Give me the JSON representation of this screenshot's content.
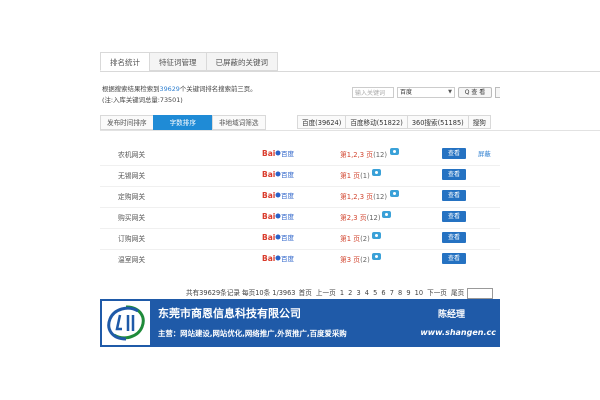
{
  "tabs_top": [
    "排名统计",
    "特征词管理",
    "已屏蔽的关键词"
  ],
  "summary": {
    "line1_prefix": "根据搜索结果检索到",
    "line1_count": "39629",
    "line1_suffix": "个关键词排名搜索前三页。",
    "line2": "(注:入库关键词总量:73501)"
  },
  "search": {
    "placeholder": "输入关键词",
    "engine_selected": "百度",
    "button_label": "Q 查 看"
  },
  "sub_tabs": [
    "发布时间排序",
    "字数排序",
    "非地域词筛选"
  ],
  "engine_tabs": [
    "百度(39624)",
    "百度移动(51822)",
    "360搜索(51185)",
    "搜狗"
  ],
  "rows": [
    {
      "keyword": "农机网关",
      "rank": "第1,2,3 页",
      "count": "(12)",
      "view": "查看",
      "extra": "屏蔽"
    },
    {
      "keyword": "无锡网关",
      "rank": "第1 页",
      "count": "(1)",
      "view": "查看",
      "extra": ""
    },
    {
      "keyword": "定购网关",
      "rank": "第1,2,3 页",
      "count": "(12)",
      "view": "查看",
      "extra": ""
    },
    {
      "keyword": "购买网关",
      "rank": "第2,3 页",
      "count": "(12)",
      "view": "查看",
      "extra": ""
    },
    {
      "keyword": "订购网关",
      "rank": "第1 页",
      "count": "(2)",
      "view": "查看",
      "extra": ""
    },
    {
      "keyword": "温室网关",
      "rank": "第3 页",
      "count": "(2)",
      "view": "查看",
      "extra": ""
    }
  ],
  "baidu_logo_text": "Bai百度",
  "pager": {
    "summary": "共有39629条记录 每页10条 1/3963",
    "first": "首页",
    "prev": "上一页",
    "pages": [
      "1",
      "2",
      "3",
      "4",
      "5",
      "6",
      "7",
      "8",
      "9",
      "10"
    ],
    "next": "下一页",
    "last": "尾页"
  },
  "banner": {
    "company": "东莞市商恩信息科技有限公司",
    "manager": "陈经理",
    "services": "主营：网站建设,网站优化,网络推广,外贸推广,百度爱采购",
    "site": "www.shangen.cc"
  },
  "colors": {
    "accent": "#1f8bd6",
    "banner": "#1f5aa8",
    "rank_red": "#d2452f",
    "view_button": "#2572c2"
  }
}
